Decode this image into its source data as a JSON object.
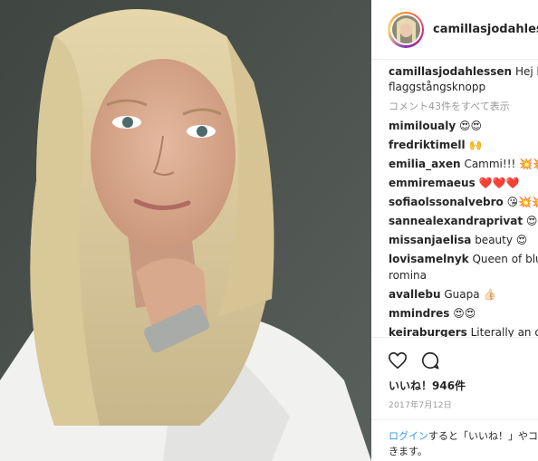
{
  "post": {
    "username": "camillasjodahlessen",
    "caption_user": "camillasjodahlessen",
    "caption_text_line1": "Hej hopp",
    "caption_text_line2": "flaggstångsknopp",
    "view_all_comments": "コメント43件をすべて表示"
  },
  "comments": [
    {
      "user": "mimiloualy",
      "text": "😍😍"
    },
    {
      "user": "fredriktimell",
      "text": "🙌"
    },
    {
      "user": "emilia_axen",
      "text": "Cammi!!! 💥💥💥"
    },
    {
      "user": "emmiremaeus",
      "text": "❤️❤️❤️"
    },
    {
      "user": "sofiaolssonalvebro",
      "text": "😘💥💥"
    },
    {
      "user": "sannealexandraprivat",
      "text": "😍"
    },
    {
      "user": "missanjaelisa",
      "text": "beauty 😍"
    },
    {
      "user": "lovisamelnyk",
      "text": "Queen of blurry",
      "text_line2": "romina"
    },
    {
      "user": "avallebu",
      "text": "Guapa 👍🏻"
    },
    {
      "user": "mmindres",
      "text": "😍😍"
    },
    {
      "user": "keiraburgers",
      "text": "Literally an older"
    }
  ],
  "actions": {
    "likes": "いいね！946件",
    "date": "2017年7月12日",
    "login_link": "ログイン",
    "login_text_line1": "すると「いいね！」やコ",
    "login_text_line2": "きます。"
  },
  "icons": {
    "like": "heart-icon",
    "comment": "comment-icon"
  },
  "colors": {
    "link": "#3897f0",
    "muted": "#999999",
    "text": "#262626"
  }
}
